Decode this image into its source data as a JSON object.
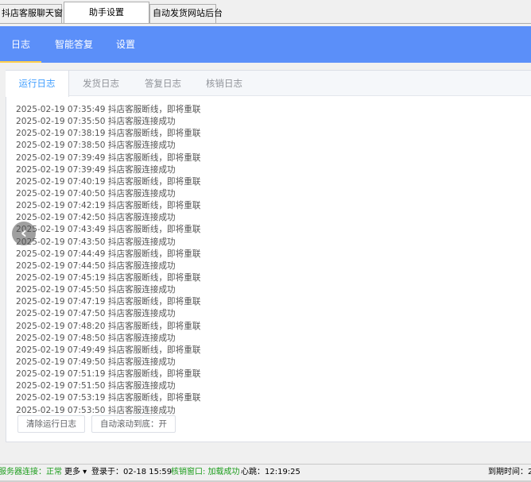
{
  "window_tabs": [
    "抖店客服聊天窗口",
    "助手设置",
    "自动发货网站后台"
  ],
  "nav": {
    "items": [
      "日志",
      "智能答复",
      "设置"
    ],
    "active": 0,
    "color": "#5b8ff9"
  },
  "sub_tabs": [
    "运行日志",
    "发货日志",
    "答复日志",
    "核销日志"
  ],
  "log_lines": [
    "2025-02-19 07:35:49 抖店客服断线，即将重联",
    "2025-02-19 07:35:50 抖店客服连接成功",
    "2025-02-19 07:38:19 抖店客服断线，即将重联",
    "2025-02-19 07:38:50 抖店客服连接成功",
    "2025-02-19 07:39:49 抖店客服断线，即将重联",
    "2025-02-19 07:39:49 抖店客服连接成功",
    "2025-02-19 07:40:19 抖店客服断线，即将重联",
    "2025-02-19 07:40:50 抖店客服连接成功",
    "2025-02-19 07:42:19 抖店客服断线，即将重联",
    "2025-02-19 07:42:50 抖店客服连接成功",
    "2025-02-19 07:43:49 抖店客服断线，即将重联",
    "2025-02-19 07:43:50 抖店客服连接成功",
    "2025-02-19 07:44:49 抖店客服断线，即将重联",
    "2025-02-19 07:44:50 抖店客服连接成功",
    "2025-02-19 07:45:19 抖店客服断线，即将重联",
    "2025-02-19 07:45:50 抖店客服连接成功",
    "2025-02-19 07:47:19 抖店客服断线，即将重联",
    "2025-02-19 07:47:50 抖店客服连接成功",
    "2025-02-19 07:48:20 抖店客服断线，即将重联",
    "2025-02-19 07:48:50 抖店客服连接成功",
    "2025-02-19 07:49:49 抖店客服断线，即将重联",
    "2025-02-19 07:49:50 抖店客服连接成功",
    "2025-02-19 07:51:19 抖店客服断线，即将重联",
    "2025-02-19 07:51:50 抖店客服连接成功",
    "2025-02-19 07:53:19 抖店客服断线，即将重联",
    "2025-02-19 07:53:50 抖店客服连接成功"
  ],
  "buttons": {
    "clear_log": "清除运行日志",
    "auto_scroll": "自动滚动到底：开"
  },
  "scroll_arrow_icon": "chevron-left-icon",
  "status": {
    "server": "服务器连接：正常",
    "more": "更多 ▾",
    "login": "登录于：02-18 15:59",
    "verify_window": "核销窗口: 加载成功",
    "heartbeat": "心跳：12:19:25",
    "expire": "到期时间：2"
  }
}
